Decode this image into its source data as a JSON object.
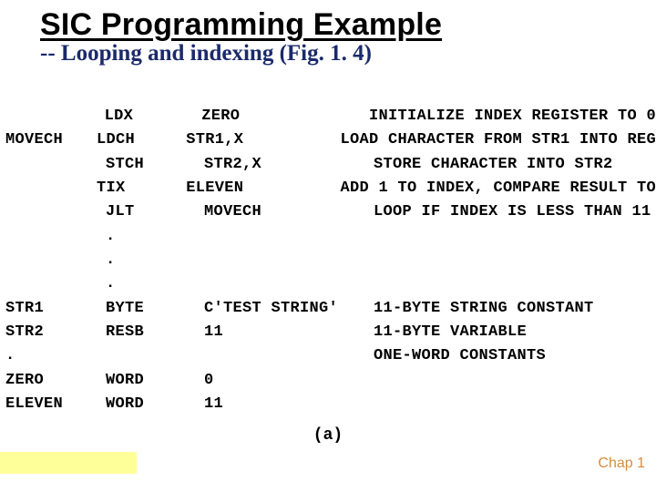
{
  "header": {
    "title": "SIC Programming Example",
    "subtitle": "-- Looping and indexing (Fig. 1. 4)"
  },
  "code": {
    "rows": [
      {
        "label": "",
        "opcode": "LDX",
        "operand": "ZERO",
        "comment": "INITIALIZE INDEX REGISTER TO 0"
      },
      {
        "label": "MOVECH",
        "opcode": "LDCH",
        "operand": "STR1,X",
        "comment": "LOAD CHARACTER FROM STR1 INTO REG"
      },
      {
        "label": "",
        "opcode": "STCH",
        "operand": "STR2,X",
        "comment": "STORE CHARACTER INTO STR2"
      },
      {
        "label": "",
        "opcode": "TIX",
        "operand": "ELEVEN",
        "comment": "ADD 1 TO INDEX, COMPARE RESULT TO"
      },
      {
        "label": "",
        "opcode": "JLT",
        "operand": "MOVECH",
        "comment": "LOOP IF INDEX IS LESS THAN 11"
      },
      {
        "label": "",
        "opcode": ".",
        "operand": "",
        "comment": ""
      },
      {
        "label": "",
        "opcode": ".",
        "operand": "",
        "comment": ""
      },
      {
        "label": "",
        "opcode": ".",
        "operand": "",
        "comment": ""
      },
      {
        "label": "STR1",
        "opcode": "BYTE",
        "operand": "C'TEST STRING'",
        "comment": "11-BYTE STRING CONSTANT"
      },
      {
        "label": "STR2",
        "opcode": "RESB",
        "operand": "11",
        "comment": "11-BYTE VARIABLE"
      },
      {
        "label": ".",
        "opcode": "",
        "operand": "",
        "comment": "ONE-WORD CONSTANTS"
      },
      {
        "label": "ZERO",
        "opcode": "WORD",
        "operand": "0",
        "comment": ""
      },
      {
        "label": "ELEVEN",
        "opcode": "WORD",
        "operand": "11",
        "comment": ""
      }
    ]
  },
  "figlabel": "(a)",
  "chapter": "Chap 1"
}
